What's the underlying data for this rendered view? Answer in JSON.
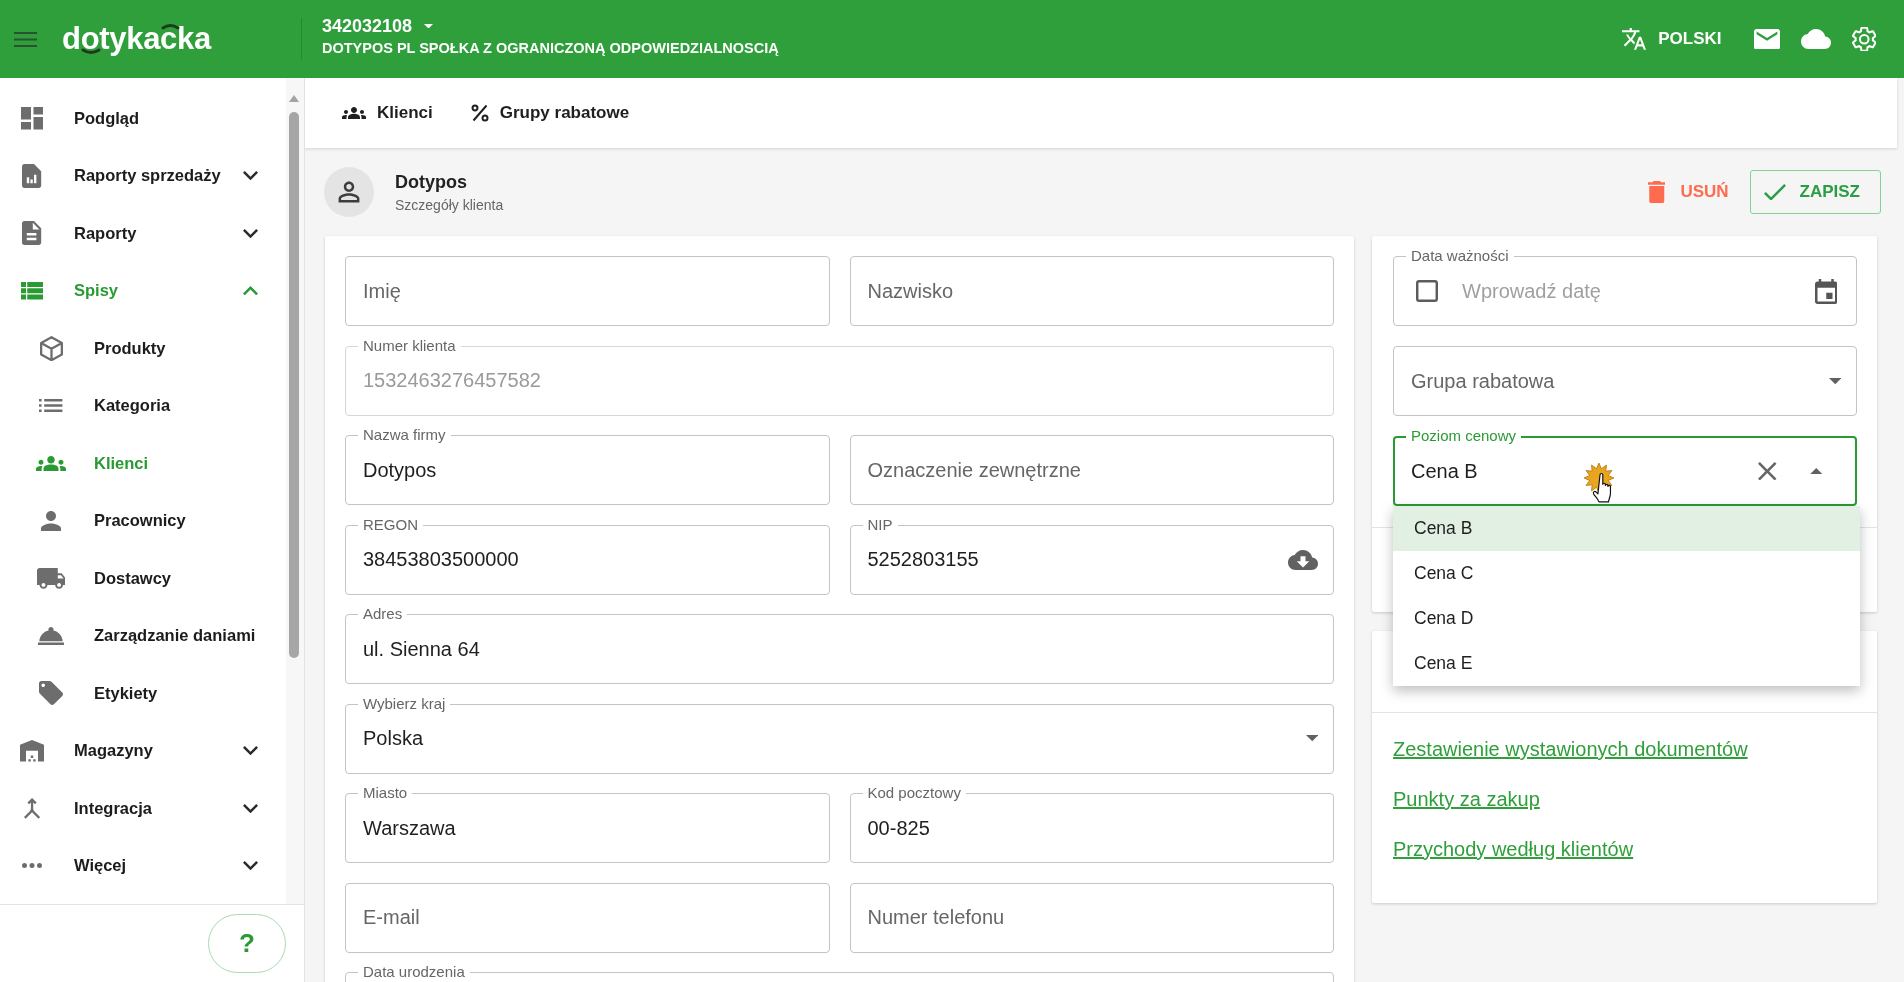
{
  "header": {
    "logo": "dotykacka",
    "account": {
      "number": "342032108",
      "company": "DOTYPOS PL SPOŁKA Z OGRANICZONĄ ODPOWIEDZIALNOSCIĄ"
    },
    "language": "POLSKI"
  },
  "sidebar": {
    "items": [
      {
        "kind": "page",
        "label": "Podgląd",
        "selected": false
      },
      {
        "kind": "group",
        "label": "Raporty sprzedaży",
        "selected": false,
        "expanded": false
      },
      {
        "kind": "group",
        "label": "Raporty",
        "selected": false,
        "expanded": false
      },
      {
        "kind": "group",
        "label": "Spisy",
        "selected": true,
        "expanded": true,
        "children": [
          {
            "label": "Produkty",
            "selected": false
          },
          {
            "label": "Kategoria",
            "selected": false
          },
          {
            "label": "Klienci",
            "selected": true
          },
          {
            "label": "Pracownicy",
            "selected": false
          },
          {
            "label": "Dostawcy",
            "selected": false
          },
          {
            "label": "Zarządzanie daniami",
            "selected": false
          },
          {
            "label": "Etykiety",
            "selected": false
          }
        ]
      },
      {
        "kind": "group",
        "label": "Magazyny",
        "selected": false,
        "expanded": false
      },
      {
        "kind": "group",
        "label": "Integracja",
        "selected": false,
        "expanded": false
      },
      {
        "kind": "group",
        "label": "Więcej",
        "selected": false,
        "expanded": false
      }
    ],
    "help": "?"
  },
  "subnav": {
    "items": [
      {
        "label": "Klienci"
      },
      {
        "label": "Grupy rabatowe"
      }
    ]
  },
  "customer": {
    "name": "Dotypos",
    "subtitle": "Szczegóły klienta"
  },
  "actions": [
    {
      "kind": "delete",
      "label": "USUŃ"
    },
    {
      "kind": "save",
      "label": "ZAPISZ"
    }
  ],
  "form": {
    "rows": [
      [
        {
          "kind": "text",
          "placeholder": "Imię",
          "disabled": false
        },
        {
          "kind": "text",
          "placeholder": "Nazwisko",
          "disabled": false
        }
      ],
      [
        {
          "kind": "text",
          "label": "Numer klienta",
          "value": "1532463276457582",
          "disabled": true
        }
      ],
      [
        {
          "kind": "text",
          "label": "Nazwa firmy",
          "value": "Dotypos",
          "disabled": false
        },
        {
          "kind": "text",
          "placeholder": "Oznaczenie zewnętrzne",
          "disabled": false
        }
      ],
      [
        {
          "kind": "text",
          "label": "REGON",
          "value": "38453803500000",
          "disabled": false
        },
        {
          "kind": "lookup",
          "label": "NIP",
          "value": "5252803155",
          "disabled": false
        }
      ],
      [
        {
          "kind": "text",
          "label": "Adres",
          "value": "ul. Sienna 64",
          "disabled": false
        }
      ],
      [
        {
          "kind": "select",
          "label": "Wybierz kraj",
          "value": "Polska",
          "open": false,
          "disabled": false
        }
      ],
      [
        {
          "kind": "text",
          "label": "Miasto",
          "value": "Warszawa",
          "disabled": false
        },
        {
          "kind": "text",
          "label": "Kod pocztowy",
          "value": "00-825",
          "disabled": false
        }
      ],
      [
        {
          "kind": "text",
          "placeholder": "E-mail",
          "disabled": false
        },
        {
          "kind": "text",
          "placeholder": "Numer telefonu",
          "disabled": false
        }
      ],
      [
        {
          "kind": "text",
          "label": "Data urodzenia",
          "disabled": false
        }
      ]
    ]
  },
  "side_form": {
    "fields": [
      {
        "kind": "date",
        "label": "Data ważności",
        "placeholder": "Wprowadź datę",
        "checked": false,
        "focused": false
      },
      {
        "kind": "select",
        "placeholder": "Grupa rabatowa",
        "open": false,
        "focused": false
      },
      {
        "kind": "select",
        "label": "Poziom cenowy",
        "value": "Cena B",
        "open": true,
        "focused": true,
        "options": [
          {
            "label": "Cena B",
            "selected": true
          },
          {
            "label": "Cena C",
            "selected": false
          },
          {
            "label": "Cena D",
            "selected": false
          },
          {
            "label": "Cena E",
            "selected": false
          }
        ]
      }
    ]
  },
  "side_links": [
    "Zestawienie wystawionych dokumentów",
    "Punkty za zakup",
    "Przychody według klientów"
  ]
}
